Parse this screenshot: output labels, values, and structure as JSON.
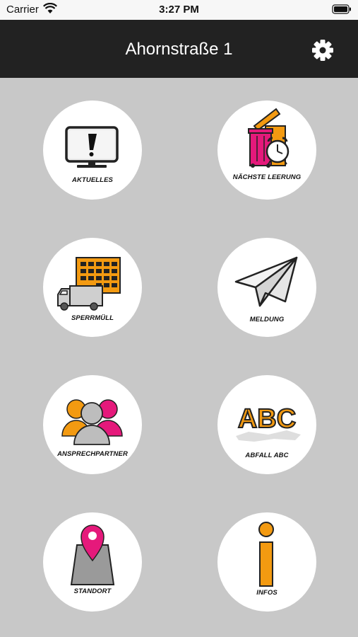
{
  "status_bar": {
    "carrier": "Carrier",
    "time": "3:27 PM"
  },
  "header": {
    "title": "Ahornstraße 1",
    "settings_icon": "gear-icon"
  },
  "colors": {
    "accent_orange": "#f39a11",
    "accent_magenta": "#e5197b",
    "header_bg": "#222222",
    "page_bg": "#c8c8c8"
  },
  "tiles": [
    {
      "label": "AKTUELLES",
      "icon": "monitor-alert-icon"
    },
    {
      "label": "NÄCHSTE LEERUNG",
      "icon": "bin-alarm-clock-icon"
    },
    {
      "label": "SPERRMÜLL",
      "icon": "truck-calendar-icon"
    },
    {
      "label": "MELDUNG",
      "icon": "paper-plane-icon"
    },
    {
      "label": "ANSPRECHPARTNER",
      "icon": "contacts-icon"
    },
    {
      "label": "ABFALL ABC",
      "icon": "abc-icon",
      "icon_text": "ABC"
    },
    {
      "label": "STANDORT",
      "icon": "location-pin-icon"
    },
    {
      "label": "INFOS",
      "icon": "info-icon"
    }
  ]
}
